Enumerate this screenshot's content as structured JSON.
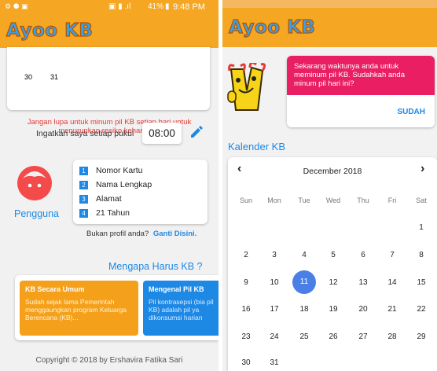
{
  "left_screen": {
    "status": {
      "time": "9:48 PM",
      "battery": "41%"
    },
    "app_title": "Ayoo KB",
    "calendar_tail": {
      "days": [
        "30",
        "31"
      ]
    },
    "reminder_text": "Jangan lupa untuk minum pil KB setiap hari untuk menurunkan resiko kehamilan.",
    "remind_label": "Ingatkan saya setiap pukul",
    "remind_time": "08:00",
    "profile": {
      "label": "Pengguna",
      "items": [
        {
          "num": "1",
          "text": "Nomor Kartu"
        },
        {
          "num": "2",
          "text": "Nama Lengkap"
        },
        {
          "num": "3",
          "text": "Alamat"
        },
        {
          "num": "4",
          "text": "21 Tahun"
        }
      ],
      "not_you": "Bukan profil anda?",
      "change": "Ganti Disini."
    },
    "why_title": "Mengapa Harus KB ?",
    "info_cards": [
      {
        "title": "KB Secara Umum",
        "body": "Sudah sejak lama Pemerintah menggaungkan program Keluarga Berencana (KB)...",
        "color": "#f5a01a"
      },
      {
        "title": "Mengenal Pil KB",
        "body": "Pil kontrasepsi (bia pil KB) adalah pil ya dikonsumsi harian",
        "color": "#1e88e5"
      }
    ],
    "copyright": "Copyright © 2018 by Ershavira Fatika Sari"
  },
  "right_screen": {
    "app_title": "Ayoo KB",
    "notification": {
      "message": "Sekarang waktunya anda untuk meminum pil KB. Sudahkah anda minum pil hari ini?",
      "action": "SUDAH"
    },
    "section_title": "Kalender KB",
    "calendar": {
      "month": "December 2018",
      "prev": "‹",
      "next": "›",
      "weekdays": [
        "Sun",
        "Mon",
        "Tue",
        "Wed",
        "Thu",
        "Fri",
        "Sat"
      ],
      "weeks": [
        [
          "",
          "",
          "",
          "",
          "",
          "",
          "1"
        ],
        [
          "2",
          "3",
          "4",
          "5",
          "6",
          "7",
          "8"
        ],
        [
          "9",
          "10",
          "11",
          "12",
          "13",
          "14",
          "15"
        ],
        [
          "16",
          "17",
          "18",
          "19",
          "20",
          "21",
          "22"
        ],
        [
          "23",
          "24",
          "25",
          "26",
          "27",
          "28",
          "29"
        ],
        [
          "30",
          "31",
          "",
          "",
          "",
          "",
          ""
        ]
      ],
      "selected": "11"
    }
  },
  "colors": {
    "orange": "#f5a623",
    "blue": "#1e88e5",
    "pink": "#e91e63",
    "red_text": "#e53935",
    "avatar": "#f44a4a"
  }
}
